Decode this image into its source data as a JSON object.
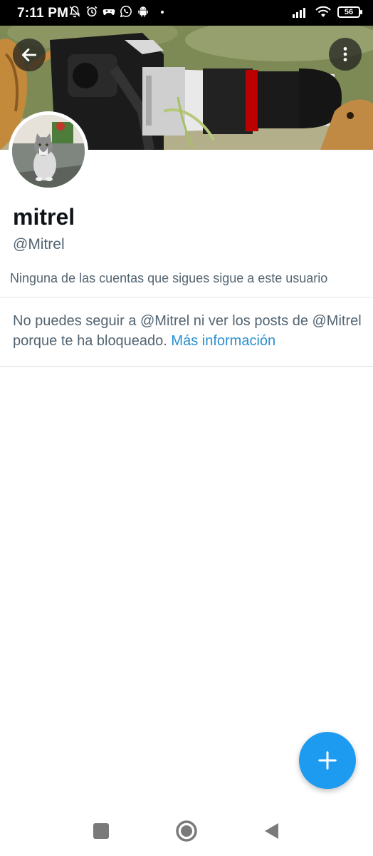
{
  "status_bar": {
    "time": "7:11 PM",
    "battery": "56",
    "icons_left": [
      "bell-off-icon",
      "alarm-icon",
      "game-controller-icon",
      "whatsapp-icon",
      "android-icon"
    ],
    "icons_right": [
      "signal-icon",
      "wifi-icon",
      "battery-icon"
    ]
  },
  "header": {
    "back_icon": "arrow-left-icon",
    "menu_icon": "more-vertical-icon"
  },
  "profile": {
    "name": "mitrel",
    "handle": "@Mitrel",
    "follow_note": "Ninguna de las cuentas que sigues sigue a este usuario"
  },
  "blocked": {
    "message": "No puedes seguir a @Mitrel ni ver los posts de @Mitrel porque te ha bloqueado.",
    "link_label": "Más información"
  },
  "fab": {
    "icon": "plus-icon"
  },
  "nav": {
    "icons": [
      "recents-square-icon",
      "home-circle-icon",
      "back-triangle-icon"
    ]
  },
  "colors": {
    "accent": "#1d9bf0",
    "text_primary": "#0f1419",
    "text_secondary": "#536471"
  }
}
